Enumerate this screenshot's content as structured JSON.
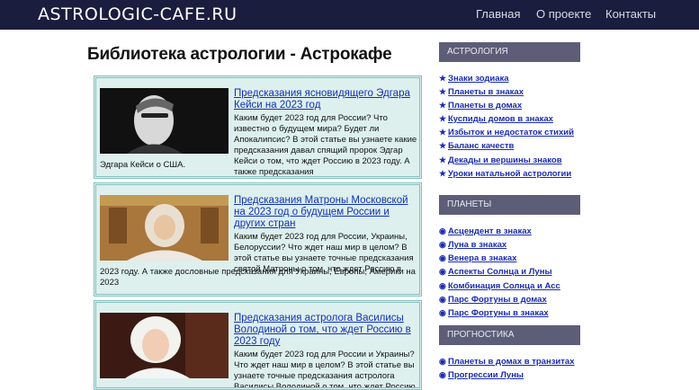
{
  "header": {
    "logo": "ASTROLOGIC-CAFE.RU",
    "nav": [
      "Главная",
      "О проекте",
      "Контакты"
    ]
  },
  "main": {
    "title": "Библиотека астрологии - Астрокафе",
    "articles": [
      {
        "title": "Предсказания ясновидящего Эдгара Кейси на 2023 год",
        "text_side": "Каким будет 2023 год для России? Что известно о будущем мира? Будет ли Апокалипсис? В этой статье вы узнаете какие предсказания давал спящий пророк Эдгар Кейси о том, что ждет Россию в 2023 году. А также предсказания",
        "text_full": "Эдгара Кейси о США."
      },
      {
        "title": "Предсказания Матроны Московской на 2023 год о будущем России и других стран",
        "text_side": "Каким будет 2023 год для России, Украины, Белоруссии? Что ждет наш мир в целом? В этой статье вы узнаете точные предсказания святой Матроны о том, что ждет Россию в",
        "text_full": "2023 году. А также дословные предсказания для Украины, Европы, Америки на 2023"
      },
      {
        "title": "Предсказания астролога Василисы Володиной о том, что ждет Россию в 2023 году",
        "text_side": "Каким будет 2023 год для России и Украины? Что ждет наш мир в целом? В этой статье вы узнаете точные предсказания астролога Василисы Володиной о том, что ждет Россию в",
        "text_full": ""
      }
    ]
  },
  "sidebar": {
    "sections": [
      {
        "title": "АСТРОЛОГИЯ",
        "icon": "star-icon",
        "items": [
          "Знаки зодиака",
          "Планеты в знаках",
          "Планеты в домах",
          "Куспиды домов в знаках",
          "Избыток и недостаток стихий",
          "Баланс качеств",
          "Декады и вершины знаков",
          "Уроки натальной астрологии"
        ]
      },
      {
        "title": "ПЛАНЕТЫ",
        "icon": "planet-icon",
        "items": [
          "Асцендент в знаках",
          "Луна в знаках",
          "Венера в знаках",
          "Аспекты Солнца и Луны",
          "Комбинация Солнца и Асс",
          "Парс Фортуны в домах",
          "Парс Фортуны в знаках"
        ]
      },
      {
        "title": "ПРОГНОСТИКА",
        "icon": "planet-icon",
        "items": [
          "Планеты в домах в транзитах",
          "Прогрессии Луны"
        ]
      }
    ]
  },
  "colors": {
    "topbar": "#1b1d3e",
    "article_bg": "#ddf0ee",
    "article_border": "#86bfc0",
    "link": "#1030b8",
    "sidebar_head": "#5d5d78"
  }
}
